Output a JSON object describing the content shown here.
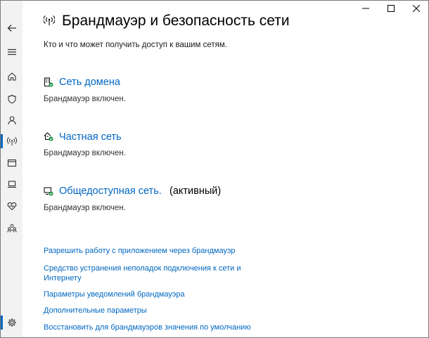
{
  "window": {
    "title": "Брандмауэр и безопасность сети",
    "subtitle": "Кто и что может получить доступ к вашим сетям."
  },
  "networks": [
    {
      "name": "Сеть домена",
      "status": "Брандмауэр включен.",
      "active_label": ""
    },
    {
      "name": "Частная сеть",
      "status": "Брандмауэр включен.",
      "active_label": ""
    },
    {
      "name": "Общедоступная сеть.",
      "status": "Брандмауэр включен.",
      "active_label": "(активный)"
    }
  ],
  "links": [
    "Разрешить работу с приложением через брандмауэр",
    "Средство устранения неполадок подключения к сети и Интернету",
    "Параметры уведомлений брандмауэра",
    "Дополнительные параметры",
    "Восстановить для брандмауэров значения по умолчанию"
  ],
  "nav_icons": [
    "back-icon",
    "menu-icon",
    "home-icon",
    "shield-icon",
    "account-icon",
    "network-icon",
    "app-browser-icon",
    "device-security-icon",
    "device-health-icon",
    "family-icon",
    "settings-icon"
  ],
  "colors": {
    "accent": "#0067c0",
    "sidebar": "#f2f2f2",
    "status_ok": "#10893e"
  }
}
